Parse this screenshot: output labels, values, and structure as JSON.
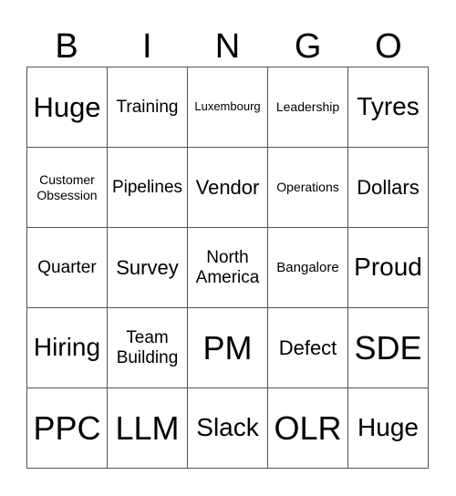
{
  "header": {
    "letters": [
      "B",
      "I",
      "N",
      "G",
      "O"
    ]
  },
  "cells": [
    [
      {
        "text": "Huge",
        "size": "xl"
      },
      {
        "text": "Training",
        "size": "m"
      },
      {
        "text": "Luxembourg",
        "size": "xs"
      },
      {
        "text": "Leadership",
        "size": "xs"
      },
      {
        "text": "Tyres",
        "size": "l"
      }
    ],
    [
      {
        "text": "Customer Obsession",
        "size": "xs"
      },
      {
        "text": "Pipelines",
        "size": "m"
      },
      {
        "text": "Vendor",
        "size": "ml"
      },
      {
        "text": "Operations",
        "size": "xs"
      },
      {
        "text": "Dollars",
        "size": "ml"
      }
    ],
    [
      {
        "text": "Quarter",
        "size": "m"
      },
      {
        "text": "Survey",
        "size": "ml"
      },
      {
        "text": "North America",
        "size": "m"
      },
      {
        "text": "Bangalore",
        "size": "s"
      },
      {
        "text": "Proud",
        "size": "l"
      }
    ],
    [
      {
        "text": "Hiring",
        "size": "l"
      },
      {
        "text": "Team Building",
        "size": "m"
      },
      {
        "text": "PM",
        "size": "xxl"
      },
      {
        "text": "Defect",
        "size": "ml"
      },
      {
        "text": "SDE",
        "size": "xxl"
      }
    ],
    [
      {
        "text": "PPC",
        "size": "xxl"
      },
      {
        "text": "LLM",
        "size": "xxl"
      },
      {
        "text": "Slack",
        "size": "l"
      },
      {
        "text": "OLR",
        "size": "xxl"
      },
      {
        "text": "Huge",
        "size": "l"
      }
    ]
  ]
}
